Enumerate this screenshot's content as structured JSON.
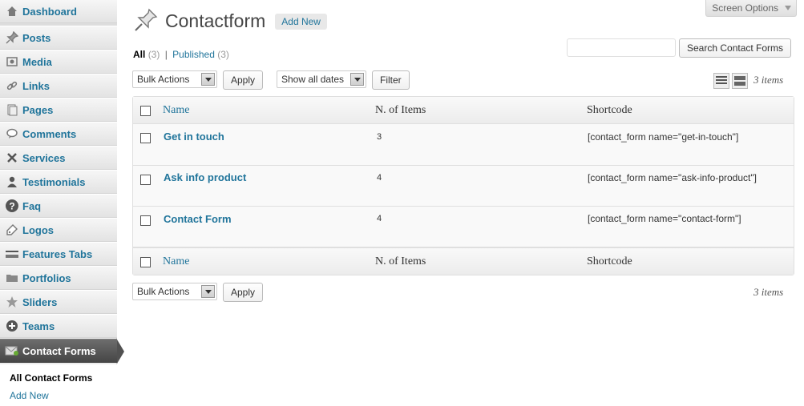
{
  "sidebar": {
    "items": [
      {
        "label": "Dashboard",
        "icon": "dashboard-icon"
      },
      {
        "label": "Posts",
        "icon": "pin-icon"
      },
      {
        "label": "Media",
        "icon": "media-icon"
      },
      {
        "label": "Links",
        "icon": "link-icon"
      },
      {
        "label": "Pages",
        "icon": "pages-icon"
      },
      {
        "label": "Comments",
        "icon": "comment-icon"
      },
      {
        "label": "Services",
        "icon": "tools-icon"
      },
      {
        "label": "Testimonials",
        "icon": "user-icon"
      },
      {
        "label": "Faq",
        "icon": "question-icon"
      },
      {
        "label": "Logos",
        "icon": "tag-icon"
      },
      {
        "label": "Features Tabs",
        "icon": "tabs-icon"
      },
      {
        "label": "Portfolios",
        "icon": "folder-icon"
      },
      {
        "label": "Sliders",
        "icon": "star-icon"
      },
      {
        "label": "Teams",
        "icon": "plus-circle-icon"
      },
      {
        "label": "Contact Forms",
        "icon": "envelope-icon"
      }
    ],
    "submenu": {
      "all": "All Contact Forms",
      "add_new": "Add New"
    }
  },
  "header": {
    "screen_options": "Screen Options",
    "title": "Contactform",
    "add_new": "Add New"
  },
  "filters": {
    "all_label": "All",
    "all_count": "(3)",
    "separator": "|",
    "published_label": "Published",
    "published_count": "(3)"
  },
  "search": {
    "placeholder": "",
    "button": "Search Contact Forms"
  },
  "bulk_top": {
    "select": "Bulk Actions",
    "apply": "Apply"
  },
  "dates": {
    "select": "Show all dates",
    "filter": "Filter"
  },
  "items_count": "3 items",
  "table": {
    "columns": [
      "Name",
      "N. of Items",
      "Shortcode"
    ],
    "rows": [
      {
        "name": "Get in touch",
        "items": "3",
        "shortcode": "[contact_form name=\"get-in-touch\"]"
      },
      {
        "name": "Ask info product",
        "items": "4",
        "shortcode": "[contact_form name=\"ask-info-product\"]"
      },
      {
        "name": "Contact Form",
        "items": "4",
        "shortcode": "[contact_form name=\"contact-form\"]"
      }
    ]
  },
  "bulk_bottom": {
    "select": "Bulk Actions",
    "apply": "Apply"
  },
  "colors": {
    "link": "#21759b",
    "active_menu": "#464646"
  }
}
